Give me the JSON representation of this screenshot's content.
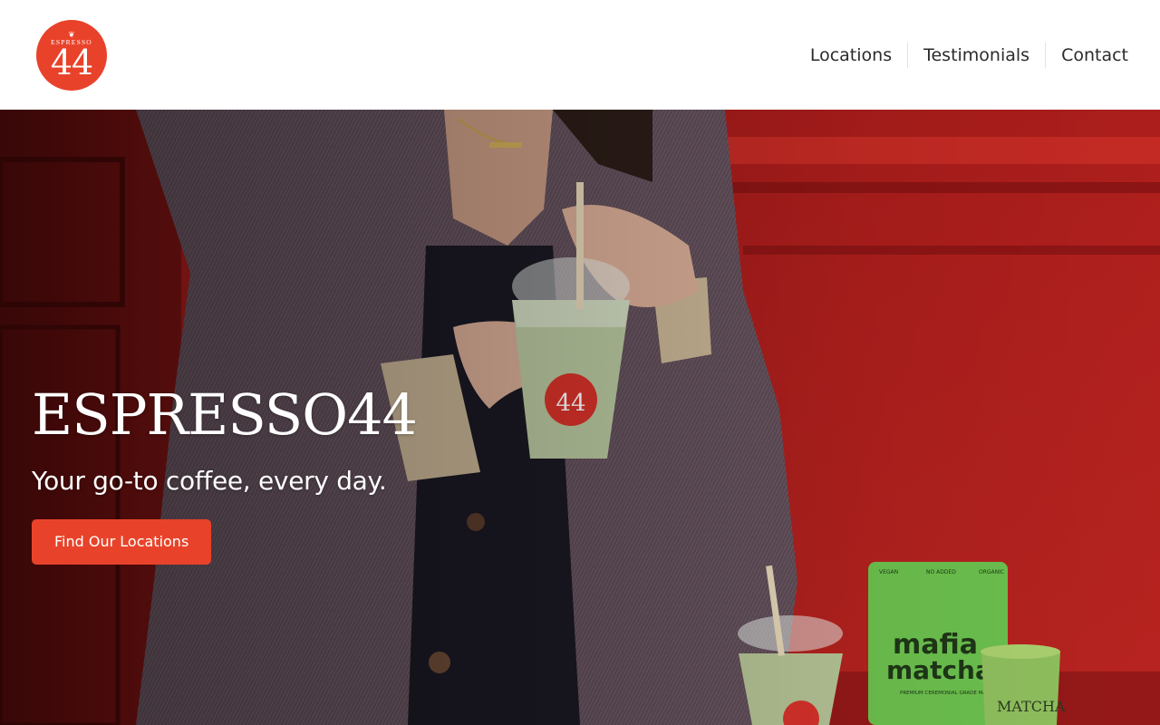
{
  "colors": {
    "brand": "#e8432a",
    "header_bg": "#ffffff",
    "nav_text": "#2b2b2b",
    "wall": "#b8201e"
  },
  "logo": {
    "top_text": "ESPRESSO",
    "number": "44",
    "mark": "❦"
  },
  "nav": {
    "items": [
      "Locations",
      "Testimonials",
      "Contact"
    ]
  },
  "hero": {
    "title": "ESPRESSO44",
    "subtitle": "Your go-to coffee, every day.",
    "button": "Find Our Locations",
    "cup_label": "44",
    "bag_brand": "mafia matcha",
    "bag_tags": [
      "VEGAN",
      "NO ADDED SUGAR",
      "ORGANIC"
    ],
    "bag_subtitle": "PREMIUM CEREMONIAL GRADE MATCHA",
    "tin_label": "MATCHA"
  }
}
